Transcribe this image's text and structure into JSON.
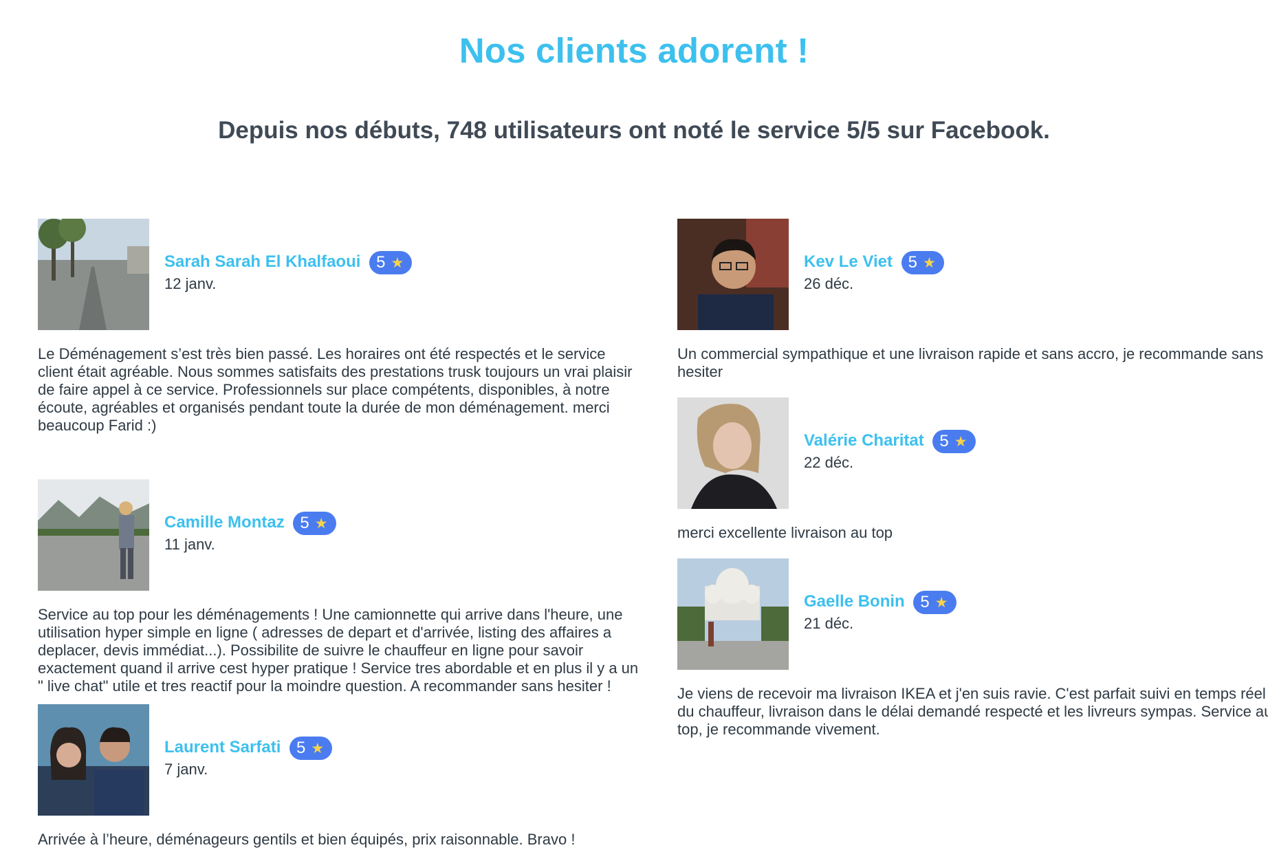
{
  "title": "Nos clients adorent !",
  "subtitle": "Depuis nos débuts, 748 utilisateurs ont noté le service 5/5 sur Facebook.",
  "star_glyph": "★",
  "reviews_left": [
    {
      "name": "Sarah Sarah El Khalfaoui",
      "rating": "5",
      "date": "12 janv.",
      "text": "Le Déménagement s’est très bien passé. Les horaires ont été respectés et le service client était agréable. Nous sommes satisfaits des prestations trusk toujours un vrai plaisir de faire appel à ce service. Professionnels sur place compétents, disponibles, à notre écoute, agréables et organisés pendant toute la durée de mon déménagement. merci beaucoup Farid :)"
    },
    {
      "name": "Camille Montaz",
      "rating": "5",
      "date": "11 janv.",
      "text": "Service au top pour les déménagements ! Une camionnette qui arrive dans l'heure, une utilisation hyper simple en ligne ( adresses de depart et d'arrivée, listing des affaires a deplacer, devis immédiat...). Possibilite de suivre le chauffeur en ligne pour savoir exactement quand il arrive cest hyper pratique ! Service tres abordable et en plus il y a un \" live chat\" utile et tres reactif pour la moindre question. A recommander sans hesiter !"
    },
    {
      "name": "Laurent Sarfati",
      "rating": "5",
      "date": "7 janv.",
      "text": "Arrivée à l’heure, déménageurs gentils et bien équipés, prix raisonnable. Bravo !"
    }
  ],
  "reviews_right": [
    {
      "name": "Kev Le Viet",
      "rating": "5",
      "date": "26 déc.",
      "text": "Un commercial sympathique et une livraison rapide et sans accro, je recommande sans hesiter"
    },
    {
      "name": "Valérie Charitat",
      "rating": "5",
      "date": "22 déc.",
      "text": "merci excellente livraison au top"
    },
    {
      "name": "Gaelle Bonin",
      "rating": "5",
      "date": "21 déc.",
      "text": "Je viens de recevoir ma livraison IKEA et j'en suis ravie. C'est parfait suivi en temps réel du chauffeur, livraison dans le délai demandé respecté et les livreurs sympas. Service au top, je recommande vivement."
    }
  ]
}
